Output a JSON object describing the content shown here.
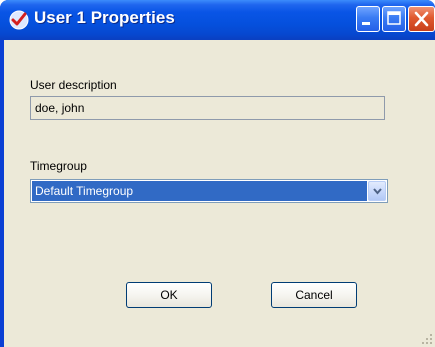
{
  "window": {
    "title": "User 1 Properties",
    "icon": "checkmark-icon",
    "title_color": "#ffffff",
    "titlebar_color": "#0550dd"
  },
  "titlebar_buttons": {
    "minimize": "minimize-icon",
    "maximize": "maximize-icon",
    "close": "close-icon"
  },
  "form": {
    "user_description_label": "User description",
    "user_description_value": "doe, john",
    "timegroup_label": "Timegroup",
    "timegroup_selected": "Default Timegroup",
    "selection_color": "#316ac5"
  },
  "buttons": {
    "ok_label": "OK",
    "cancel_label": "Cancel"
  }
}
